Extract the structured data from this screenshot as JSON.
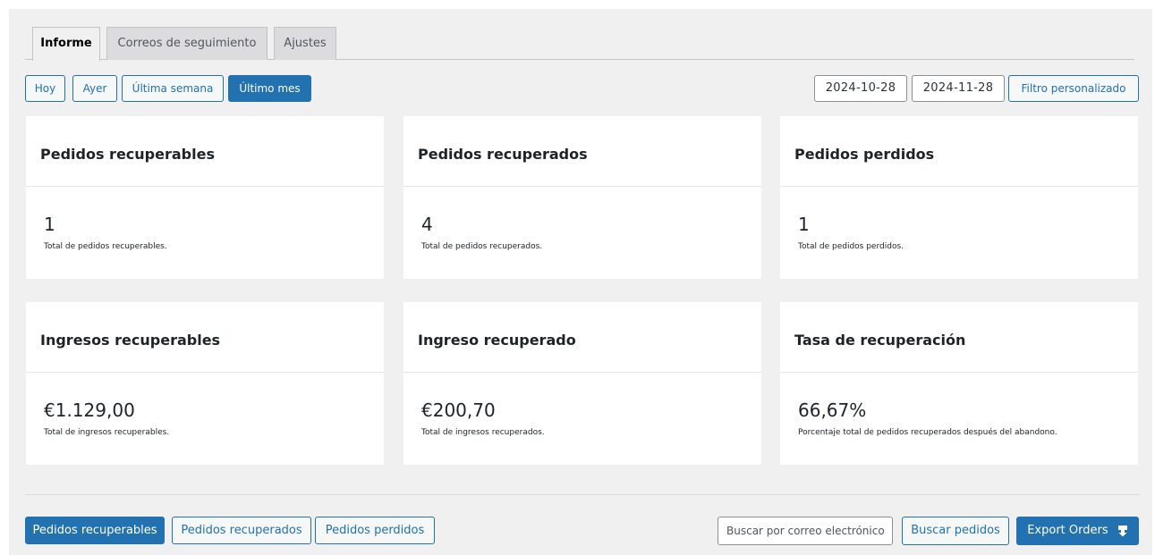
{
  "tabs": [
    {
      "label": "Informe",
      "active": true
    },
    {
      "label": "Correos de seguimiento",
      "active": false
    },
    {
      "label": "Ajustes",
      "active": false
    }
  ],
  "range_buttons": [
    {
      "label": "Hoy",
      "active": false
    },
    {
      "label": "Ayer",
      "active": false
    },
    {
      "label": "Última semana",
      "active": false
    },
    {
      "label": "Último mes",
      "active": true
    }
  ],
  "date_filter": {
    "start": "2024-10-28",
    "end": "2024-11-28",
    "custom_label": "Filtro personalizado"
  },
  "cards": [
    {
      "title": "Pedidos recuperables",
      "value": "1",
      "desc": "Total de pedidos recuperables."
    },
    {
      "title": "Pedidos recuperados",
      "value": "4",
      "desc": "Total de pedidos recuperados."
    },
    {
      "title": "Pedidos perdidos",
      "value": "1",
      "desc": "Total de pedidos perdidos."
    },
    {
      "title": "Ingresos recuperables",
      "value": "€1.129,00",
      "desc": "Total de ingresos recuperables."
    },
    {
      "title": "Ingreso recuperado",
      "value": "€200,70",
      "desc": "Total de ingresos recuperados."
    },
    {
      "title": "Tasa de recuperación",
      "value": "66,67%",
      "desc": "Porcentaje total de pedidos recuperados después del abandono."
    }
  ],
  "order_tabs": [
    {
      "label": "Pedidos recuperables",
      "active": true
    },
    {
      "label": "Pedidos recuperados",
      "active": false
    },
    {
      "label": "Pedidos perdidos",
      "active": false
    }
  ],
  "search": {
    "placeholder": "Buscar por correo electrónico",
    "button_label": "Buscar pedidos"
  },
  "export": {
    "label": "Export Orders",
    "icon": "download-icon"
  },
  "colors": {
    "accent": "#2271b1",
    "background": "#f0f0f1",
    "card": "#ffffff"
  }
}
